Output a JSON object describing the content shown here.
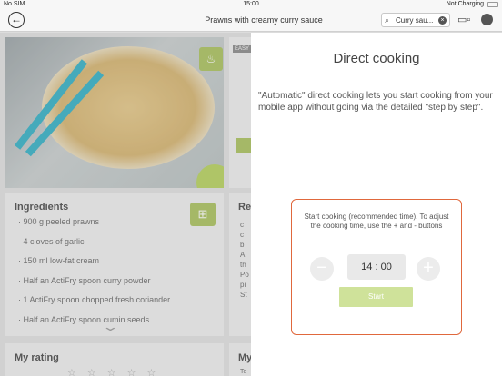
{
  "status_bar": {
    "carrier": "No SIM",
    "time": "15:00",
    "battery_status": "Not Charging"
  },
  "nav": {
    "back_icon": "back-arrow-icon",
    "title": "Prawns with creamy curry sauce",
    "search_value": "Curry sau..."
  },
  "recipe": {
    "difficulty_tag": "EASY",
    "ingredients_title": "Ingredients",
    "ingredients": [
      "900 g peeled prawns",
      "4 cloves of garlic",
      "150 ml low-fat cream",
      "Half an ActiFry spoon curry powder",
      "1 ActiFry spoon chopped fresh coriander",
      "Half an ActiFry spoon cumin seeds"
    ],
    "recipe_card_title": "Re",
    "recipe_card_lines": [
      "c",
      "c",
      "b",
      "A",
      "th",
      "Po",
      "pi",
      "St"
    ],
    "rating_title": "My rating",
    "my_card_title": "My",
    "my_card_line": "Te"
  },
  "direct_cooking": {
    "title": "Direct cooking",
    "description": "\"Automatic\" direct cooking lets you start cooking from your mobile app without going via the detailed \"step by step\".",
    "message": "Start cooking (recommended time). To adjust the cooking time, use the + and - buttons",
    "minus_label": "−",
    "plus_label": "+",
    "time": "14 : 00",
    "start_label": "Start"
  },
  "colors": {
    "accent_green": "#a9c25a",
    "start_button": "#cfe29a",
    "border_orange": "#e0683d"
  }
}
